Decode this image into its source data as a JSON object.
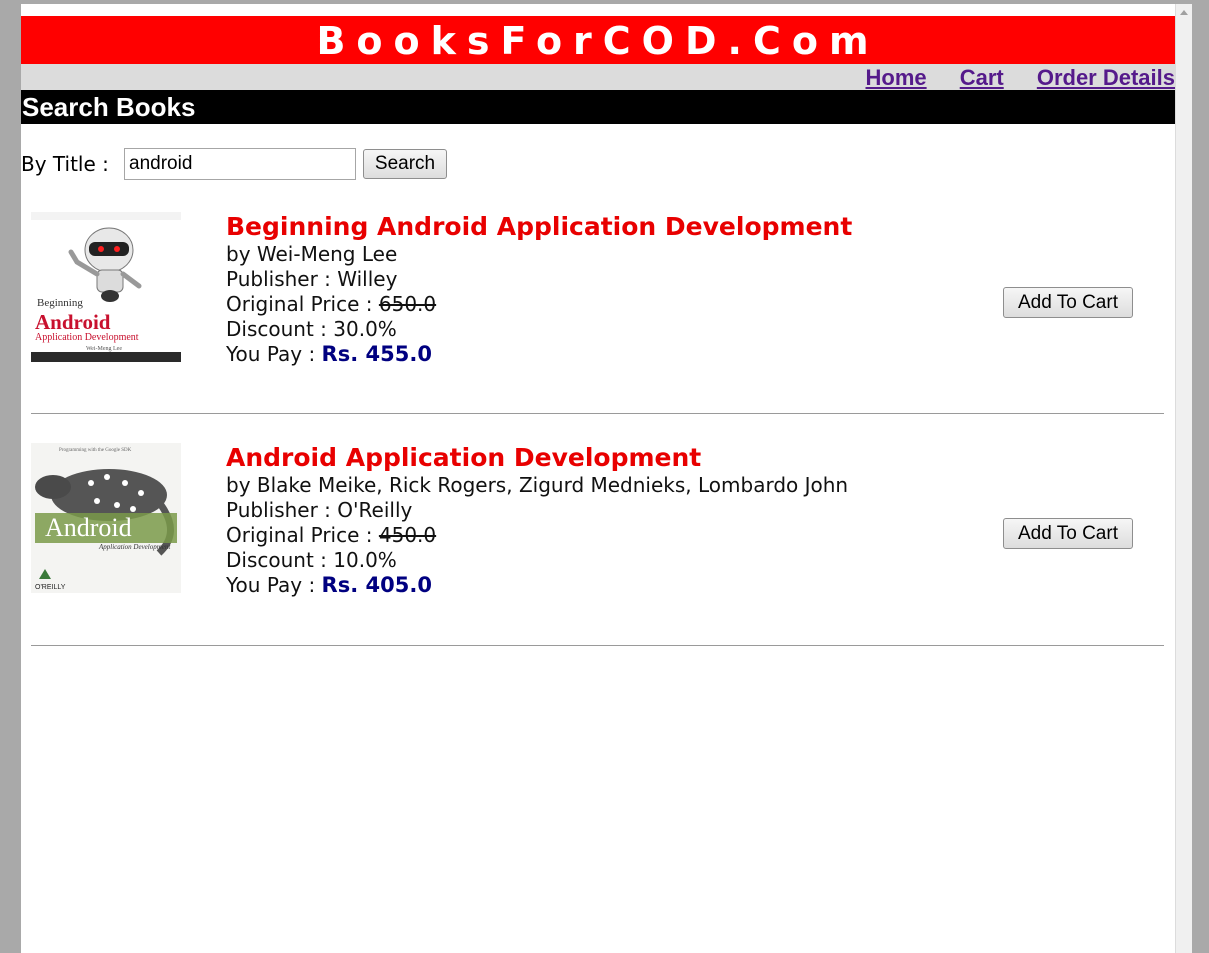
{
  "site": {
    "title": "BooksForCOD.Com"
  },
  "nav": {
    "home": "Home",
    "cart": "Cart",
    "order_details": "Order Details"
  },
  "section": {
    "title": "Search Books"
  },
  "search": {
    "label": "By Title :",
    "value": "android",
    "button": "Search"
  },
  "books": [
    {
      "title": "Beginning Android Application Development",
      "author_line": "by Wei-Meng Lee",
      "publisher_label": "Publisher :",
      "publisher": "Willey",
      "original_label": "Original Price :",
      "original_price": "650.0",
      "discount_label": "Discount :",
      "discount": "30.0%",
      "pay_label": "You Pay :",
      "pay": "Rs. 455.0",
      "button": "Add To Cart",
      "cover": {
        "top_text": "Beginning",
        "main_text": "Android",
        "sub_text": "Application Development",
        "author_text": "Wei-Meng Lee"
      }
    },
    {
      "title": "Android Application Development",
      "author_line": "by Blake Meike, Rick Rogers, Zigurd Mednieks, Lombardo John",
      "publisher_label": "Publisher :",
      "publisher": "O'Reilly",
      "original_label": "Original Price :",
      "original_price": "450.0",
      "discount_label": "Discount :",
      "discount": "10.0%",
      "pay_label": "You Pay :",
      "pay": "Rs. 405.0",
      "button": "Add To Cart",
      "cover": {
        "top_text": "Programming with the Google SDK",
        "main_text": "Android",
        "sub_text": "Application Development",
        "author_text": "O'REILLY"
      }
    }
  ],
  "colors": {
    "banner": "#ff0000",
    "title": "#e80000",
    "price": "#000080",
    "nav_link": "#551a8b"
  }
}
